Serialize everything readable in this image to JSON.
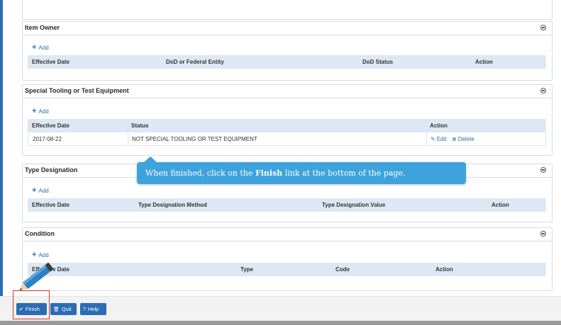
{
  "panels": {
    "item_owner": {
      "title": "Item Owner",
      "add_label": "Add",
      "columns": [
        "Effective Date",
        "DoD or Federal Entity",
        "DoD Status",
        "Action"
      ]
    },
    "special_tooling": {
      "title": "Special Tooling or Test Equipment",
      "add_label": "Add",
      "columns": [
        "Effective Date",
        "Status",
        "Action"
      ],
      "rows": [
        {
          "effective_date": "2017-08-22",
          "status": "NOT SPECIAL TOOLING OR TEST EQUIPMENT",
          "edit": "Edit",
          "delete": "Delete"
        }
      ]
    },
    "type_designation": {
      "title": "Type Designation",
      "add_label": "Add",
      "columns": [
        "Effective Date",
        "Type Designation Method",
        "Type Designation Value",
        "Action"
      ]
    },
    "condition": {
      "title": "Condition",
      "add_label": "Add",
      "columns": [
        "Effective Date",
        "Type",
        "Code",
        "Action"
      ]
    }
  },
  "tooltip": {
    "before": "When finished, click on the ",
    "bold": "Finish",
    "after": " link at the bottom of the page."
  },
  "buttons": {
    "finish": "Finish",
    "quit": "Quit",
    "help": "Help"
  },
  "colors": {
    "accent": "#2a6db5",
    "table_header": "#dce8f3",
    "tooltip": "#3ea3dd",
    "highlight": "#d9302c"
  }
}
